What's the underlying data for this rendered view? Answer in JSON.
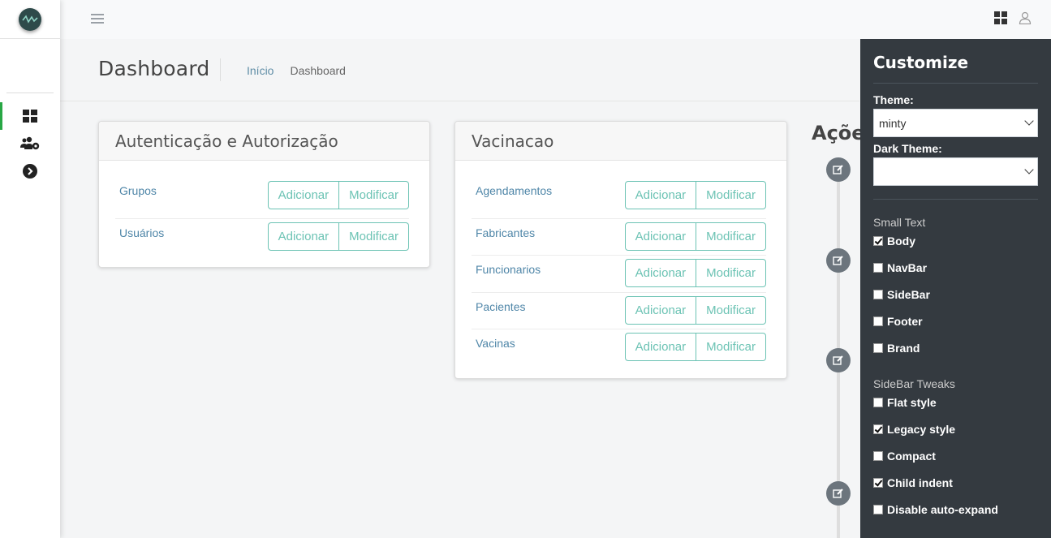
{
  "header": {
    "page_title": "Dashboard",
    "breadcrumb": [
      "Início",
      "Dashboard"
    ]
  },
  "cards": [
    {
      "title": "Autenticação e Autorização",
      "rows": [
        {
          "label": "Grupos",
          "add": "Adicionar",
          "edit": "Modificar"
        },
        {
          "label": "Usuários",
          "add": "Adicionar",
          "edit": "Modificar"
        }
      ]
    },
    {
      "title": "Vacinacao",
      "rows": [
        {
          "label": "Agendamentos",
          "add": "Adicionar",
          "edit": "Modificar"
        },
        {
          "label": "Fabricantes",
          "add": "Adicionar",
          "edit": "Modificar"
        },
        {
          "label": "Funcionarios",
          "add": "Adicionar",
          "edit": "Modificar"
        },
        {
          "label": "Pacientes",
          "add": "Adicionar",
          "edit": "Modificar"
        },
        {
          "label": "Vacinas",
          "add": "Adicionar",
          "edit": "Modificar"
        }
      ]
    }
  ],
  "actions": {
    "title": "Açõe"
  },
  "customize": {
    "title": "Customize",
    "theme_label": "Theme:",
    "theme_value": "minty",
    "dark_theme_label": "Dark Theme:",
    "dark_theme_value": "",
    "small_text_label": "Small Text",
    "small_text_options": [
      {
        "label": "Body",
        "checked": true
      },
      {
        "label": "NavBar",
        "checked": false
      },
      {
        "label": "SideBar",
        "checked": false
      },
      {
        "label": "Footer",
        "checked": false
      },
      {
        "label": "Brand",
        "checked": false
      }
    ],
    "sidebar_tweaks_label": "SideBar Tweaks",
    "sidebar_tweaks_options": [
      {
        "label": "Flat style",
        "checked": false
      },
      {
        "label": "Legacy style",
        "checked": true
      },
      {
        "label": "Compact",
        "checked": false
      },
      {
        "label": "Child indent",
        "checked": true
      },
      {
        "label": "Disable auto-expand",
        "checked": false
      }
    ]
  },
  "icons": {
    "brand": "logo-icon",
    "sidebar": [
      "dashboard-icon",
      "users-cog-icon",
      "chevron-circle-right-icon"
    ],
    "topnav": [
      "hamburger-icon",
      "th-large-icon",
      "user-icon"
    ],
    "timeline": "edit-icon"
  },
  "colors": {
    "accent": "#6cc3b4",
    "link": "#4f86a8",
    "panel_bg": "#343a40",
    "active_indicator": "#28a745"
  }
}
